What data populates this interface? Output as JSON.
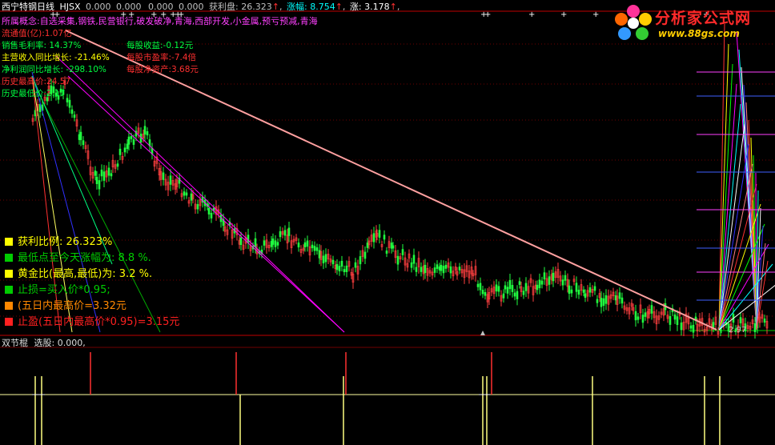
{
  "header": {
    "stock_name": "西宁特钢日线",
    "code": "HJSX",
    "v1": "0.000",
    "v2": "0.000",
    "v3": "0.000",
    "v4": "0.000",
    "profit_label": "获利盘:",
    "profit_value": "26.323",
    "rise_label": "涨幅:",
    "rise_value": "8.754",
    "zhang_label": "涨:",
    "zhang_value": "3.178"
  },
  "concept": {
    "text": "所属概念:自选采集,钢铁,民营银行,破发破净,青海,西部开发,小金属,预亏预减,青海"
  },
  "info_panel": {
    "market_cap": "流通值(亿):1.07亿",
    "gross_margin": "销售毛利率: 14.37%",
    "eps": "每股收益:-0.12元",
    "revenue_growth": "主营收入同比增长: -21.46%",
    "pe": "每股市盈率:-7.4倍",
    "profit_growth": "净利润同比增长: -298.10%",
    "nav": "每股净资产:3.68元",
    "hist_high": "历史最高价:24.57",
    "hist_low": "历史最低价:2.17"
  },
  "stats": [
    {
      "text": "获利比例: 26.323%",
      "color": "#ffff00",
      "square": "#ffff00"
    },
    {
      "text": "最低点至今天涨幅为: 8.8 %.",
      "color": "#00cc00",
      "square": "#00cc00"
    },
    {
      "text": "黄金比(最高,最低)为: 3.2 %.",
      "color": "#ffff00",
      "square": "#ffff00"
    },
    {
      "text": "止损=买入价*0.95;",
      "color": "#00cc00",
      "square": "#00cc00"
    },
    {
      "text": "(五日内最高价=3.32元",
      "color": "#ff8800",
      "square": "#ff8800"
    },
    {
      "text": "止盈(五日内最高价*0.95)=3.15元",
      "color": "#ff2020",
      "square": "#ff2020"
    }
  ],
  "logo": {
    "title": "分析家公式网",
    "url": "www.88gs.com"
  },
  "sub_panel": {
    "name": "双节棍",
    "label": "选股:",
    "value": "0.000,"
  },
  "price_tick": "2.97",
  "colors": {
    "up": "#ff3030",
    "down": "#00ffff",
    "candle_up": "#ff4040",
    "candle_down": "#20ff40",
    "trend": "#ffa0a0",
    "magenta": "#ff00ff",
    "green_line": "#00cc00"
  }
}
